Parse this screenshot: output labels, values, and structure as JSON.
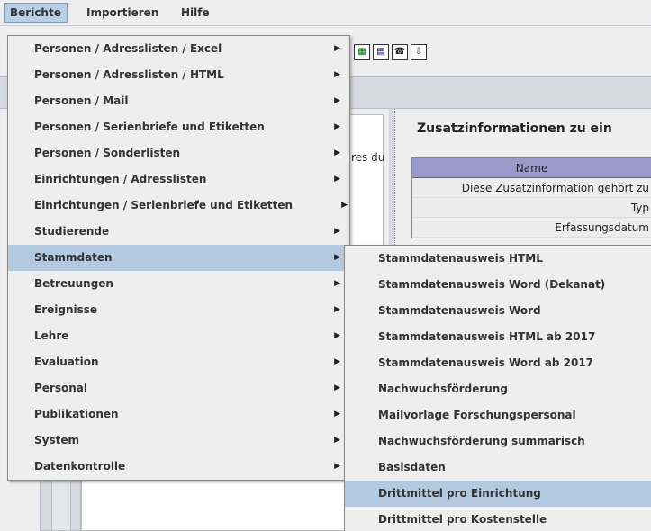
{
  "menubar": {
    "items": [
      {
        "label": "Berichte"
      },
      {
        "label": "Importieren"
      },
      {
        "label": "Hilfe"
      }
    ]
  },
  "toolbar": {
    "icons": [
      "excel-icon",
      "word-icon",
      "phone-icon",
      "export-icon"
    ]
  },
  "background": {
    "left_text_fragment": "res du",
    "panel_title": "Zusatzinformationen zu ein",
    "table_header": "Name",
    "rows": [
      "Diese Zusatzinformation gehört zu",
      "Typ",
      "Erfassungsdatum"
    ]
  },
  "menu_berichte": {
    "items": [
      {
        "label": "Personen / Adresslisten / Excel"
      },
      {
        "label": "Personen / Adresslisten / HTML"
      },
      {
        "label": "Personen / Mail"
      },
      {
        "label": "Personen / Serienbriefe und Etiketten"
      },
      {
        "label": "Personen / Sonderlisten"
      },
      {
        "label": "Einrichtungen / Adresslisten"
      },
      {
        "label": "Einrichtungen / Serienbriefe und Etiketten"
      },
      {
        "label": "Studierende"
      },
      {
        "label": "Stammdaten",
        "selected": true
      },
      {
        "label": "Betreuungen"
      },
      {
        "label": "Ereignisse"
      },
      {
        "label": "Lehre"
      },
      {
        "label": "Evaluation"
      },
      {
        "label": "Personal"
      },
      {
        "label": "Publikationen"
      },
      {
        "label": "System"
      },
      {
        "label": "Datenkontrolle"
      }
    ]
  },
  "menu_stammdaten": {
    "items": [
      {
        "label": "Stammdatenausweis HTML"
      },
      {
        "label": "Stammdatenausweis Word (Dekanat)"
      },
      {
        "label": "Stammdatenausweis Word"
      },
      {
        "label": "Stammdatenausweis HTML ab 2017"
      },
      {
        "label": "Stammdatenausweis Word ab 2017"
      },
      {
        "label": "Nachwuchsförderung"
      },
      {
        "label": "Mailvorlage Forschungspersonal"
      },
      {
        "label": "Nachwuchsförderung summarisch"
      },
      {
        "label": "Basisdaten"
      },
      {
        "label": "Drittmittel pro Einrichtung",
        "selected": true
      },
      {
        "label": "Drittmittel pro Kostenstelle"
      }
    ]
  },
  "colors": {
    "selection": "#b3c9e0",
    "table_header": "#9999cc",
    "menu_background": "#eeeeee"
  }
}
